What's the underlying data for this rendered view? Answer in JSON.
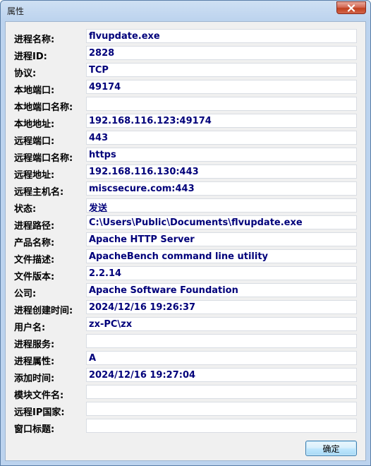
{
  "window": {
    "title": "属性"
  },
  "fields": [
    {
      "label": "进程名称:",
      "value": "flvupdate.exe"
    },
    {
      "label": "进程ID:",
      "value": "2828"
    },
    {
      "label": "协议:",
      "value": "TCP"
    },
    {
      "label": "本地端口:",
      "value": "49174"
    },
    {
      "label": "本地端口名称:",
      "value": ""
    },
    {
      "label": "本地地址:",
      "value": "192.168.116.123:49174"
    },
    {
      "label": "远程端口:",
      "value": "443"
    },
    {
      "label": "远程端口名称:",
      "value": "https"
    },
    {
      "label": "远程地址:",
      "value": "192.168.116.130:443"
    },
    {
      "label": "远程主机名:",
      "value": "miscsecure.com:443"
    },
    {
      "label": "状态:",
      "value": "发送"
    },
    {
      "label": "进程路径:",
      "value": "C:\\Users\\Public\\Documents\\flvupdate.exe"
    },
    {
      "label": "产品名称:",
      "value": "Apache HTTP Server"
    },
    {
      "label": "文件描述:",
      "value": "ApacheBench command line utility"
    },
    {
      "label": "文件版本:",
      "value": "2.2.14"
    },
    {
      "label": "公司:",
      "value": "Apache Software Foundation"
    },
    {
      "label": "进程创建时间:",
      "value": "2024/12/16 19:26:37"
    },
    {
      "label": "用户名:",
      "value": "zx-PC\\zx"
    },
    {
      "label": "进程服务:",
      "value": ""
    },
    {
      "label": "进程属性:",
      "value": "A"
    },
    {
      "label": "添加时间:",
      "value": "2024/12/16 19:27:04"
    },
    {
      "label": "模块文件名:",
      "value": ""
    },
    {
      "label": "远程IP国家:",
      "value": ""
    },
    {
      "label": "窗口标题:",
      "value": ""
    }
  ],
  "buttons": {
    "ok_label": "确定"
  },
  "icons": {
    "close": "close-icon"
  }
}
